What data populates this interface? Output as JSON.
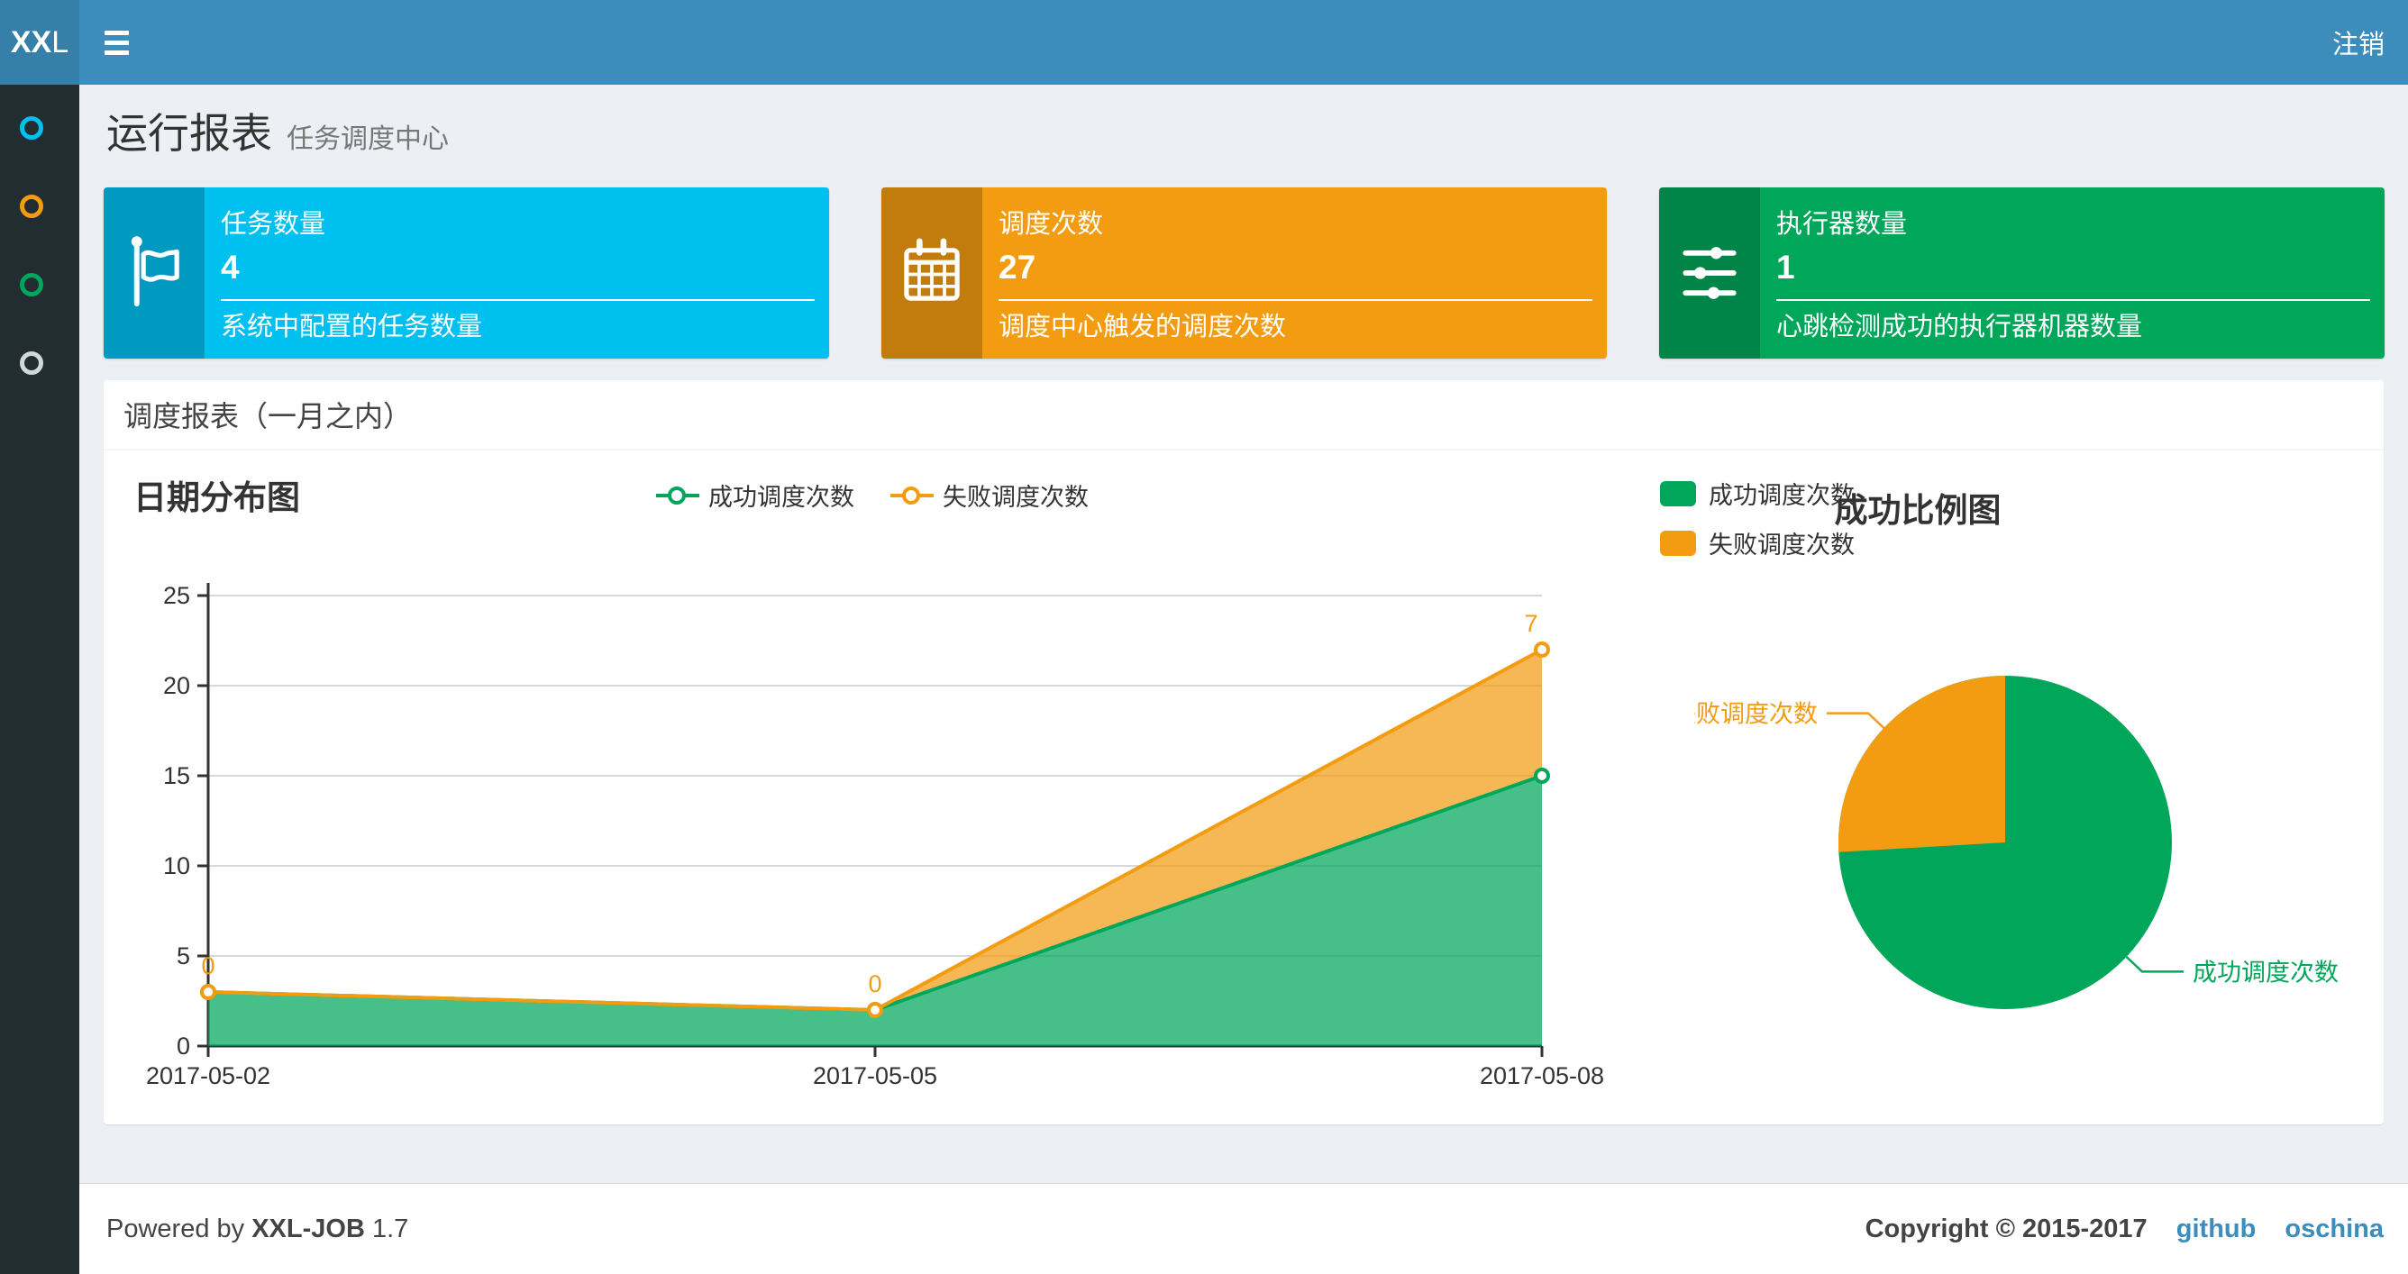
{
  "navbar": {
    "logo_bold": "XX",
    "logo_rest": "L",
    "logout": "注销"
  },
  "sidebar": {
    "items": [
      {
        "icon": "circle-icon",
        "color": "#00c0ef"
      },
      {
        "icon": "circle-icon",
        "color": "#f39c12"
      },
      {
        "icon": "circle-icon",
        "color": "#00a65a"
      },
      {
        "icon": "circle-icon",
        "color": "#d2d6de"
      }
    ]
  },
  "page_header": {
    "title": "运行报表",
    "subtitle": "任务调度中心"
  },
  "info_boxes": [
    {
      "title": "任务数量",
      "value": "4",
      "desc": "系统中配置的任务数量",
      "color": "#00c0ef",
      "icon": "flag-icon"
    },
    {
      "title": "调度次数",
      "value": "27",
      "desc": "调度中心触发的调度次数",
      "color": "#f39c12",
      "icon": "calendar-icon"
    },
    {
      "title": "执行器数量",
      "value": "1",
      "desc": "心跳检测成功的执行器机器数量",
      "color": "#00a65a",
      "icon": "sliders-icon"
    }
  ],
  "panel": {
    "title": "调度报表（一月之内）"
  },
  "chart_data": [
    {
      "type": "area",
      "title": "日期分布图",
      "categories": [
        "2017-05-02",
        "2017-05-05",
        "2017-05-08"
      ],
      "series": [
        {
          "name": "成功调度次数",
          "values": [
            3,
            2,
            15
          ],
          "color": "#00a65a"
        },
        {
          "name": "失败调度次数",
          "values": [
            0,
            0,
            7
          ],
          "color": "#f39c12"
        }
      ],
      "stacked": true,
      "point_labels": {
        "series": "失败调度次数",
        "values": [
          "0",
          "0",
          "7"
        ]
      },
      "xlabel": "",
      "ylabel": "",
      "ylim": [
        0,
        25
      ],
      "yticks": [
        0,
        5,
        10,
        15,
        20,
        25
      ],
      "grid": "horizontal",
      "legend_position": "top-center"
    },
    {
      "type": "pie",
      "title": "成功比例图",
      "slices": [
        {
          "label": "成功调度次数",
          "value": 20,
          "color": "#00a65a"
        },
        {
          "label": "失败调度次数",
          "value": 7,
          "color": "#f39c12"
        }
      ],
      "legend_position": "top-left"
    }
  ],
  "footer": {
    "powered_by": "Powered by",
    "product": "XXL-JOB",
    "version": "1.7",
    "copyright": "Copyright © 2015-2017",
    "links": [
      "github",
      "oschina"
    ]
  },
  "colors": {
    "navbar": "#3c8dbc",
    "logo_bg": "#367fa9",
    "sidebar": "#222d32",
    "content_bg": "#ecf0f5",
    "panel_bg": "#ffffff",
    "success": "#00a65a",
    "warning": "#f39c12",
    "info": "#00c0ef",
    "link": "#3c8dbc"
  }
}
